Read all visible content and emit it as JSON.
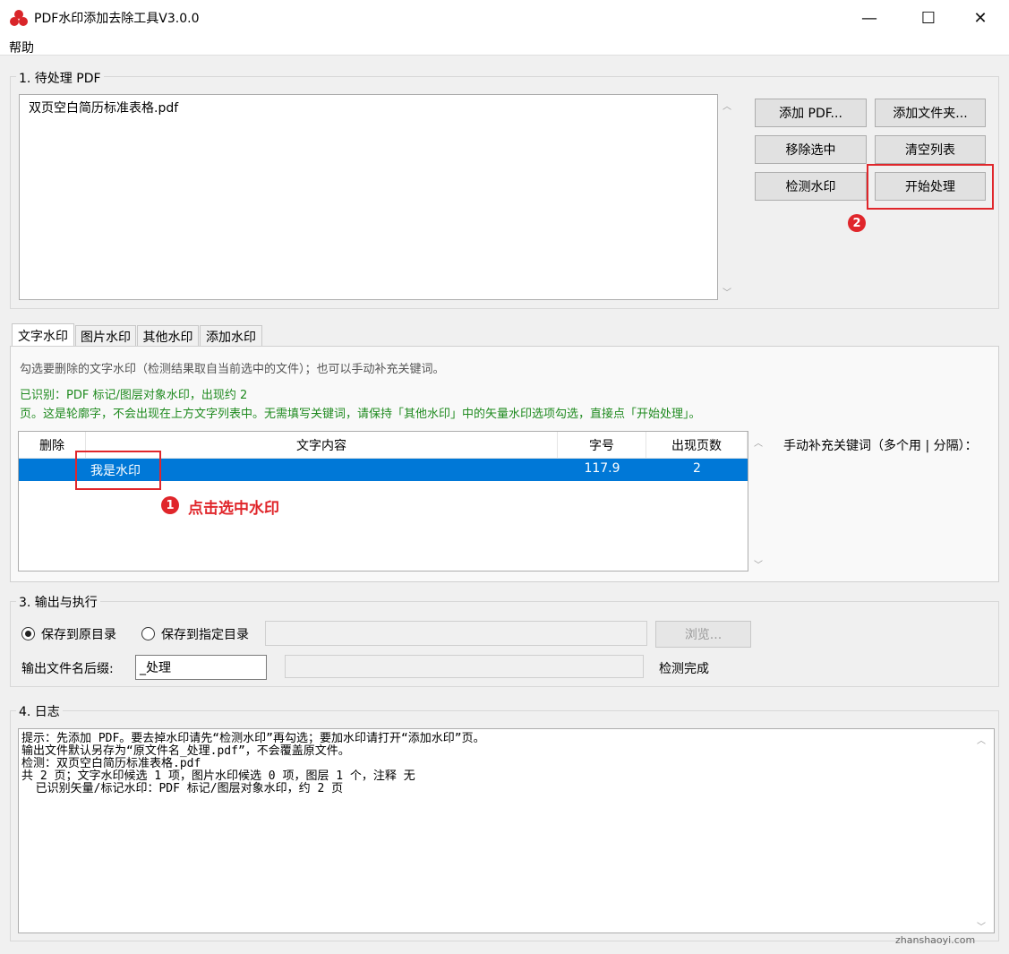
{
  "window": {
    "title": "PDF水印添加去除工具V3.0.0",
    "minimize_glyph": "—",
    "maximize_glyph": "☐",
    "close_glyph": "✕"
  },
  "menu": {
    "help": "帮助"
  },
  "section1": {
    "label": "1. 待处理 PDF",
    "files": [
      "双页空白简历标准表格.pdf"
    ],
    "buttons": {
      "add_pdf": "添加 PDF...",
      "add_folder": "添加文件夹...",
      "remove_selected": "移除选中",
      "clear_list": "清空列表",
      "detect_watermark": "检测水印",
      "start_process": "开始处理"
    }
  },
  "tabs": [
    "文字水印",
    "图片水印",
    "其他水印",
    "添加水印"
  ],
  "text_tab": {
    "hint": "勾选要删除的文字水印（检测结果取自当前选中的文件）；也可以手动补充关键词。",
    "recognized_line1": "已识别：PDF 标记/图层对象水印，出现约 2",
    "recognized_line2": "页。这是轮廓字，不会出现在上方文字列表中。无需填写关键词，请保持「其他水印」中的矢量水印选项勾选，直接点「开始处理」。",
    "columns": {
      "delete": "删除",
      "content": "文字内容",
      "size": "字号",
      "pages": "出现页数"
    },
    "rows": [
      {
        "content": "我是水印",
        "size": "117.9",
        "pages": "2"
      }
    ],
    "manual_keywords_label": "手动补充关键词（多个用 | 分隔）："
  },
  "annotations": {
    "step1_number": "1",
    "step1_text": "点击选中水印",
    "step2_number": "2",
    "color": "#e0262b"
  },
  "section3": {
    "label": "3. 输出与执行",
    "save_original": "保存到原目录",
    "save_custom": "保存到指定目录",
    "browse": "浏览...",
    "suffix_label": "输出文件名后缀:",
    "suffix_value": "_处理",
    "status": "检测完成"
  },
  "section4": {
    "label": "4. 日志",
    "log_lines": [
      "提示：先添加 PDF。要去掉水印请先“检测水印”再勾选；要加水印请打开“添加水印”页。",
      "输出文件默认另存为“原文件名_处理.pdf”，不会覆盖原文件。",
      "检测：双页空白简历标准表格.pdf",
      "共 2 页；文字水印候选 1 项，图片水印候选 0 项，图层 1 个，注释 无",
      "  已识别矢量/标记水印：PDF 标记/图层对象水印，约 2 页"
    ]
  },
  "watermark": "zhanshaoyi.com"
}
